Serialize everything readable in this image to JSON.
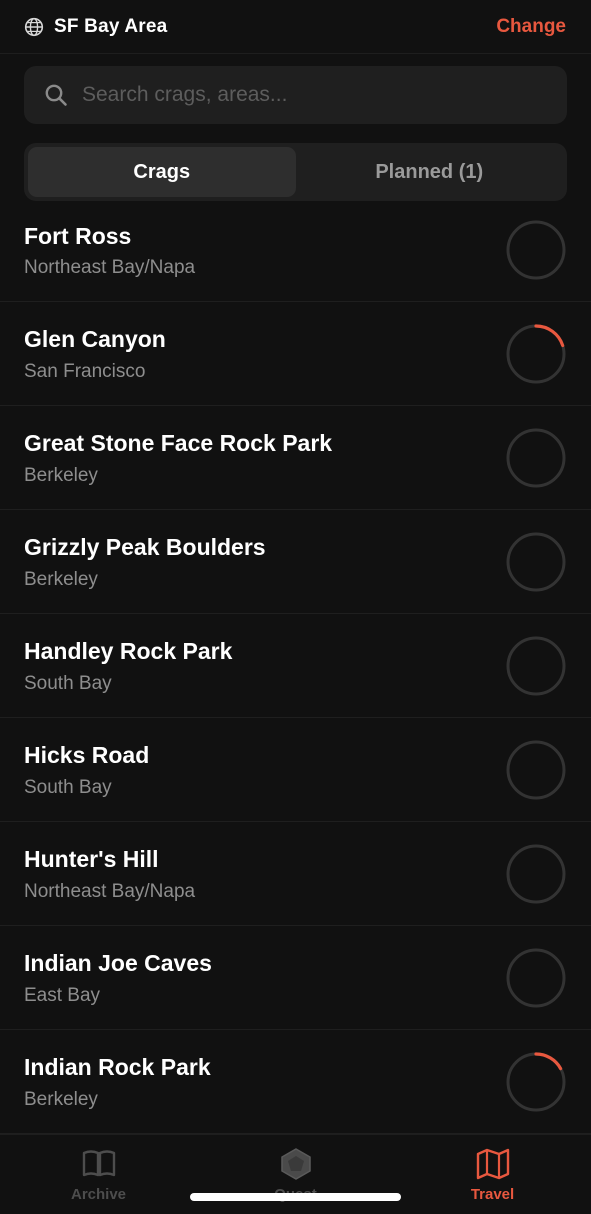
{
  "header": {
    "globe_icon": "globe-icon",
    "region": "SF Bay Area",
    "change_label": "Change"
  },
  "search": {
    "icon": "search-icon",
    "placeholder": "Search crags, areas..."
  },
  "segments": {
    "crags_label": "Crags",
    "planned_label": "Planned (1)",
    "selected": "Crags"
  },
  "crags": [
    {
      "name": "Fort Ross",
      "area": "Northeast Bay/Napa",
      "progress": 0
    },
    {
      "name": "Glen Canyon",
      "area": "San Francisco",
      "progress": 0.2
    },
    {
      "name": "Great Stone Face Rock Park",
      "area": "Berkeley",
      "progress": 0
    },
    {
      "name": "Grizzly Peak Boulders",
      "area": "Berkeley",
      "progress": 0
    },
    {
      "name": "Handley Rock Park",
      "area": "South Bay",
      "progress": 0
    },
    {
      "name": "Hicks Road",
      "area": "South Bay",
      "progress": 0
    },
    {
      "name": "Hunter's Hill",
      "area": "Northeast Bay/Napa",
      "progress": 0
    },
    {
      "name": "Indian Joe Caves",
      "area": "East Bay",
      "progress": 0
    },
    {
      "name": "Indian Rock Park",
      "area": "Berkeley",
      "progress": 0.17
    }
  ],
  "tabbar": {
    "archive_label": "Archive",
    "quest_label": "Quest",
    "travel_label": "Travel",
    "archive_icon": "book-icon",
    "quest_icon": "gem-icon",
    "travel_icon": "map-icon",
    "active": "Travel"
  },
  "colors": {
    "accent": "#e8583f",
    "background": "#111111",
    "surface": "#1f1f1f",
    "ring_track": "#333333"
  }
}
